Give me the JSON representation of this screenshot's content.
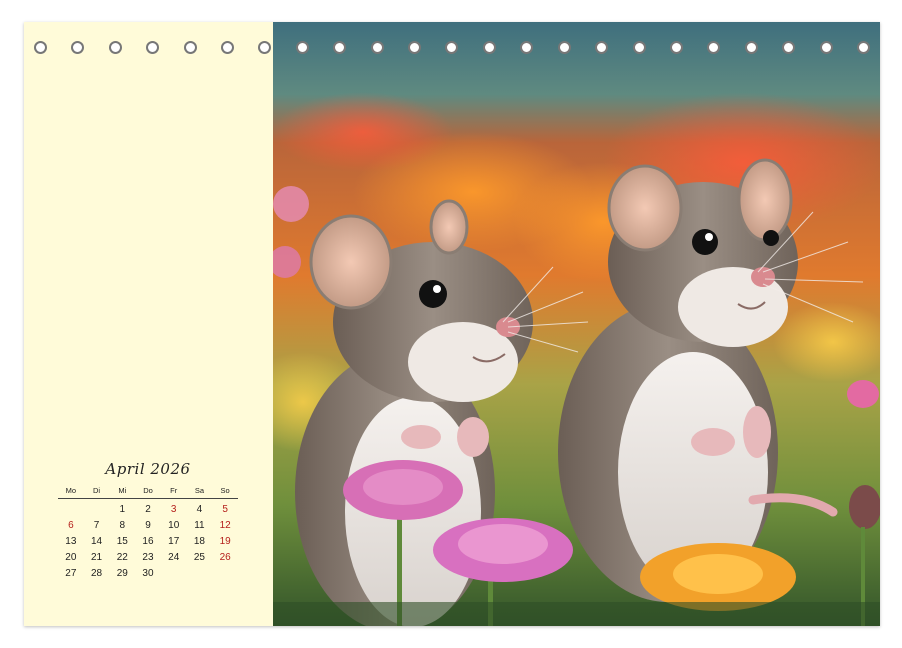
{
  "calendar": {
    "title": "April 2026",
    "weekdays": [
      "Mo",
      "Di",
      "Mi",
      "Do",
      "Fr",
      "Sa",
      "So"
    ],
    "weeks": [
      [
        "",
        "",
        "1",
        "2",
        "3",
        "4",
        "5"
      ],
      [
        "6",
        "7",
        "8",
        "9",
        "10",
        "11",
        "12"
      ],
      [
        "13",
        "14",
        "15",
        "16",
        "17",
        "18",
        "19"
      ],
      [
        "20",
        "21",
        "22",
        "23",
        "24",
        "25",
        "26"
      ],
      [
        "27",
        "28",
        "29",
        "30",
        "",
        "",
        ""
      ]
    ],
    "highlighted_days": [
      "3",
      "5",
      "6",
      "12",
      "19",
      "26"
    ],
    "highlight_color": "#b5201c"
  },
  "colors": {
    "panel_background": "#fffbd9",
    "binding_hole_border": "#777777"
  },
  "photo": {
    "subject": "two-mice-in-flower-meadow"
  }
}
